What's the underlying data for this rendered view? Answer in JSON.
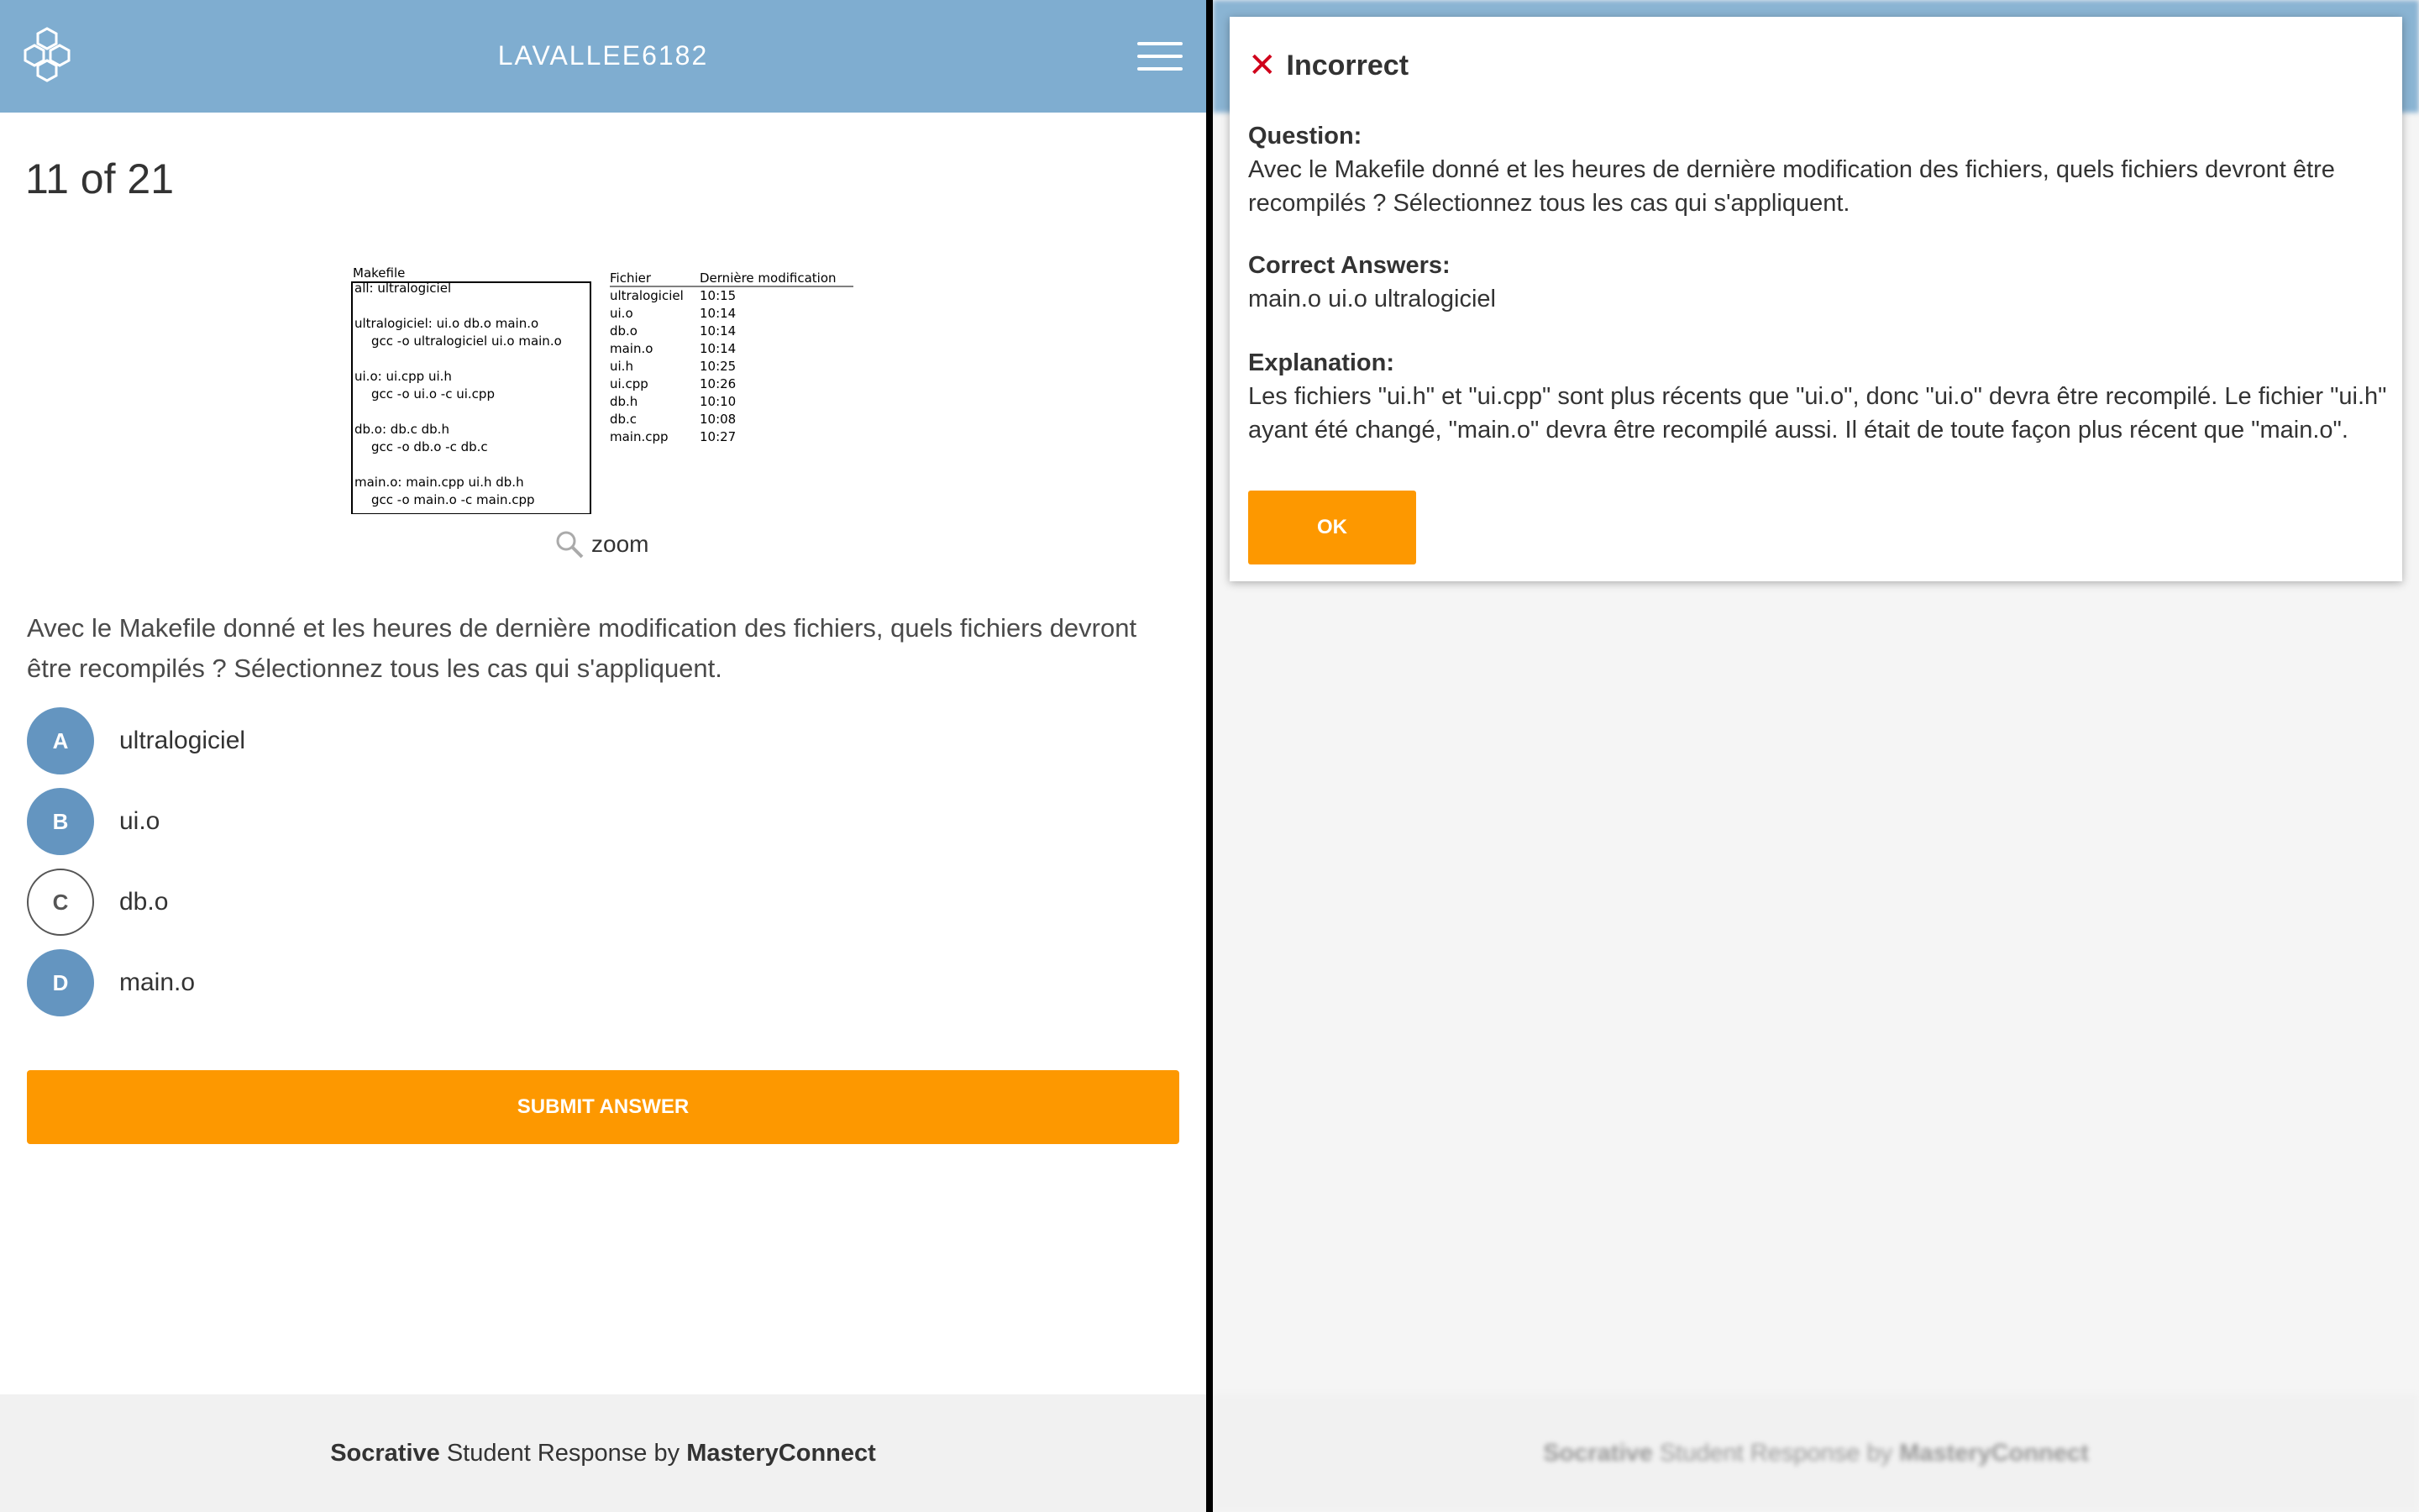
{
  "student_view": {
    "header": {
      "room_name": "LAVALLEE6182"
    },
    "progress": "11 of 21",
    "figure": {
      "makefile_title": "Makefile",
      "makefile_lines": [
        "all: ultralogiciel",
        "",
        "ultralogiciel: ui.o db.o main.o",
        "    gcc -o ultralogiciel ui.o main.o",
        "",
        "ui.o: ui.cpp ui.h",
        "    gcc -o ui.o -c ui.cpp",
        "",
        "db.o: db.c db.h",
        "    gcc -o db.o -c db.c",
        "",
        "main.o: main.cpp ui.h db.h",
        "    gcc -o main.o -c main.cpp"
      ],
      "table_headers": [
        "Fichier",
        "Dernière modification"
      ],
      "table_rows": [
        [
          "ultralogiciel",
          "10:15"
        ],
        [
          "ui.o",
          "10:14"
        ],
        [
          "db.o",
          "10:14"
        ],
        [
          "main.o",
          "10:14"
        ],
        [
          "ui.h",
          "10:25"
        ],
        [
          "ui.cpp",
          "10:26"
        ],
        [
          "db.h",
          "10:10"
        ],
        [
          "db.c",
          "10:08"
        ],
        [
          "main.cpp",
          "10:27"
        ]
      ]
    },
    "zoom_label": "zoom",
    "question_text": "Avec le Makefile donné et les heures de dernière modification des fichiers, quels fichiers devront être recompilés ? Sélectionnez tous les cas qui s'appliquent.",
    "choices": [
      {
        "letter": "A",
        "text": "ultralogiciel",
        "selected": true
      },
      {
        "letter": "B",
        "text": "ui.o",
        "selected": true
      },
      {
        "letter": "C",
        "text": "db.o",
        "selected": false
      },
      {
        "letter": "D",
        "text": "main.o",
        "selected": true
      }
    ],
    "submit_label": "SUBMIT ANSWER",
    "footer": {
      "brand": "Socrative",
      "middle": " Student Response by ",
      "company": "MasteryConnect"
    }
  },
  "feedback_modal": {
    "status": "Incorrect",
    "question_heading": "Question:",
    "question_text": "Avec le Makefile donné et les heures de dernière modification des fichiers, quels fichiers devront être recompilés ? Sélectionnez tous les cas qui s'appliquent.",
    "correct_heading": "Correct Answers:",
    "correct_text": "main.o ui.o ultralogiciel",
    "explanation_heading": "Explanation:",
    "explanation_text": "Les fichiers \"ui.h\" et \"ui.cpp\" sont plus récents que \"ui.o\", donc \"ui.o\" devra être recompilé. Le fichier \"ui.h\" ayant été changé, \"main.o\" devra être recompilé aussi. Il était de toute façon plus récent que \"main.o\".",
    "ok_label": "OK"
  },
  "colors": {
    "header_blue": "#7fadd0",
    "selected_blue": "#6495c0",
    "orange": "#fd9800",
    "incorrect_red": "#d0021b"
  }
}
